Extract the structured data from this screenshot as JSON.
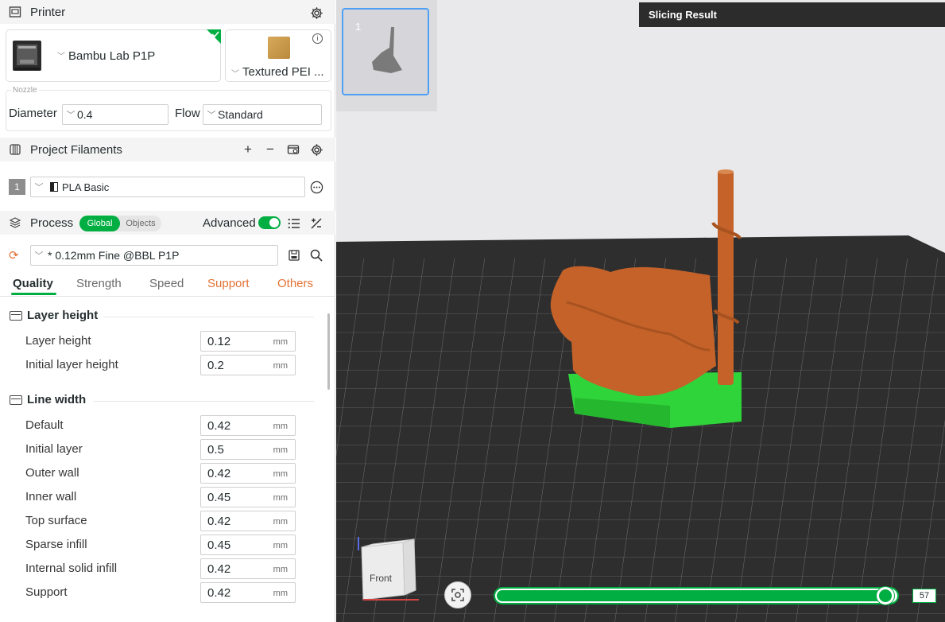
{
  "printer": {
    "section_title": "Printer",
    "name": "Bambu Lab P1P",
    "plate": "Textured PEI ...",
    "nozzle_label": "Nozzle",
    "diameter_label": "Diameter",
    "diameter": "0.4",
    "flow_label": "Flow",
    "flow": "Standard"
  },
  "filaments": {
    "section_title": "Project Filaments",
    "items": [
      {
        "index": "1",
        "name": "PLA Basic"
      }
    ]
  },
  "process": {
    "section_title": "Process",
    "mode_global": "Global",
    "mode_objects": "Objects",
    "advanced_label": "Advanced",
    "advanced_on": true,
    "preset": "* 0.12mm Fine @BBL P1P",
    "tabs": [
      "Quality",
      "Strength",
      "Speed",
      "Support",
      "Others"
    ],
    "active_tab": "Quality"
  },
  "quality": {
    "layer_height_group": "Layer height",
    "line_width_group": "Line width",
    "unit": "mm",
    "layer_height_rows": [
      {
        "label": "Layer height",
        "value": "0.12"
      },
      {
        "label": "Initial layer height",
        "value": "0.2"
      }
    ],
    "line_width_rows": [
      {
        "label": "Default",
        "value": "0.42"
      },
      {
        "label": "Initial layer",
        "value": "0.5"
      },
      {
        "label": "Outer wall",
        "value": "0.42"
      },
      {
        "label": "Inner wall",
        "value": "0.45"
      },
      {
        "label": "Top surface",
        "value": "0.42"
      },
      {
        "label": "Sparse infill",
        "value": "0.45"
      },
      {
        "label": "Internal solid infill",
        "value": "0.42"
      },
      {
        "label": "Support",
        "value": "0.42"
      }
    ]
  },
  "viewport": {
    "plate_number": "1",
    "slicing_result_label": "Slicing Result",
    "view_cube_label": "Front",
    "layer_value": "57",
    "layer_progress": 0.98
  },
  "colors": {
    "accent": "#00ae42",
    "model": "#c4622a",
    "support": "#2fd43a",
    "orange_text": "#e27234"
  }
}
